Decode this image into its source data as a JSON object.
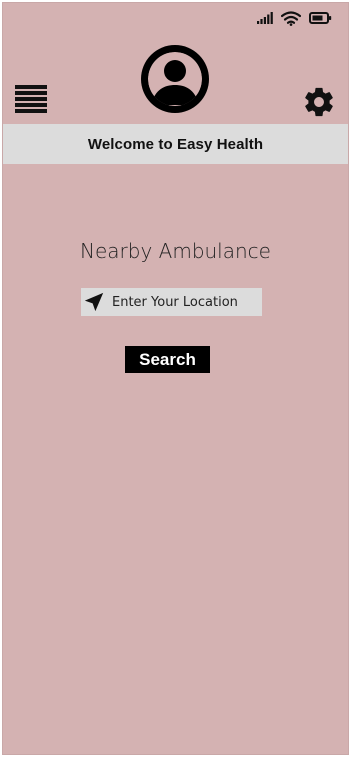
{
  "status_bar": {
    "icons": [
      "signal-icon",
      "wifi-icon",
      "battery-icon"
    ]
  },
  "header": {
    "menu_icon": "hamburger-menu-icon",
    "avatar_icon": "user-avatar-icon",
    "settings_icon": "gear-icon"
  },
  "banner": {
    "welcome_text": "Welcome to Easy Health"
  },
  "main": {
    "title": "Nearby Ambulance",
    "location_input": {
      "placeholder": "Enter Your Location",
      "value": "",
      "icon": "navigation-arrow-icon"
    },
    "search_button_label": "Search"
  },
  "colors": {
    "background": "#d4b2b2",
    "banner": "#dcdcdc",
    "input": "#dcdcdc",
    "button": "#000000",
    "button_text": "#ffffff",
    "icons": "#111111"
  }
}
